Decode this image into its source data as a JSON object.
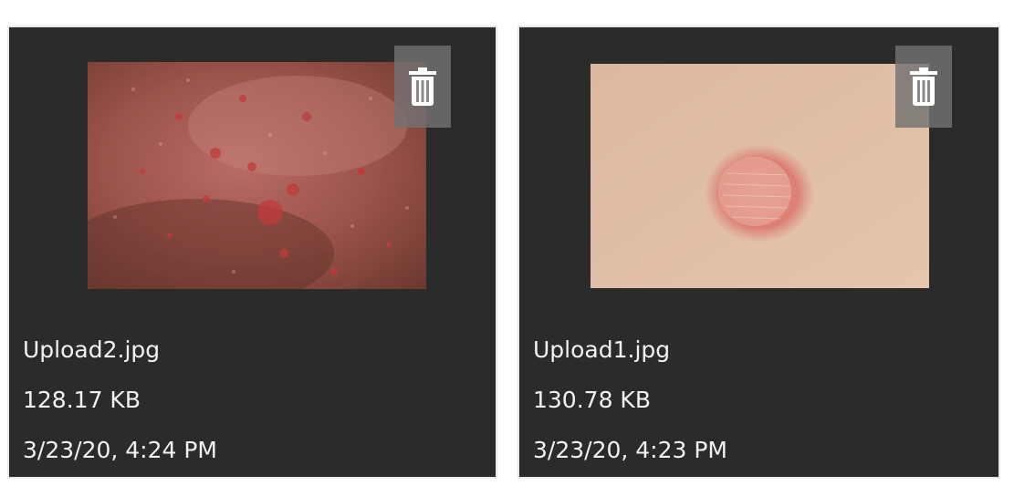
{
  "uploads": [
    {
      "filename": "Upload2.jpg",
      "size": "128.17 KB",
      "date": "3/23/20, 4:24 PM",
      "delete_icon": "trash-icon"
    },
    {
      "filename": "Upload1.jpg",
      "size": "130.78 KB",
      "date": "3/23/20, 4:23 PM",
      "delete_icon": "trash-icon"
    }
  ],
  "colors": {
    "card_background": "#2b2b2b",
    "card_border": "#e9e9e9",
    "text": "#f2f2f2",
    "delete_button": "#737373"
  }
}
